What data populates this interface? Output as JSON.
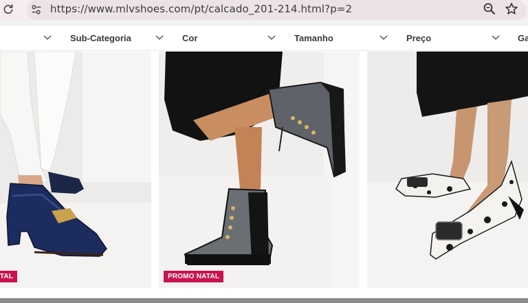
{
  "browser": {
    "url": "https://www.mlvshoes.com/pt/calcado_201-214.html?p=2",
    "icons": [
      "reload-icon",
      "site-settings-icon",
      "zoom-icon",
      "bookmark-star-icon"
    ]
  },
  "filters": [
    {
      "label": ""
    },
    {
      "label": "Sub-Categoria"
    },
    {
      "label": "Cor"
    },
    {
      "label": "Tamanho"
    },
    {
      "label": "Preço"
    },
    {
      "label": "Ga"
    }
  ],
  "products": [
    {
      "badge": "PROMO NATAL"
    },
    {
      "badge": "PROMO NATAL"
    },
    {
      "badge": ""
    }
  ],
  "colors": {
    "badge": "#c8144d",
    "tab_bar": "#f6eeee",
    "omnibox": "#ece4e4"
  }
}
